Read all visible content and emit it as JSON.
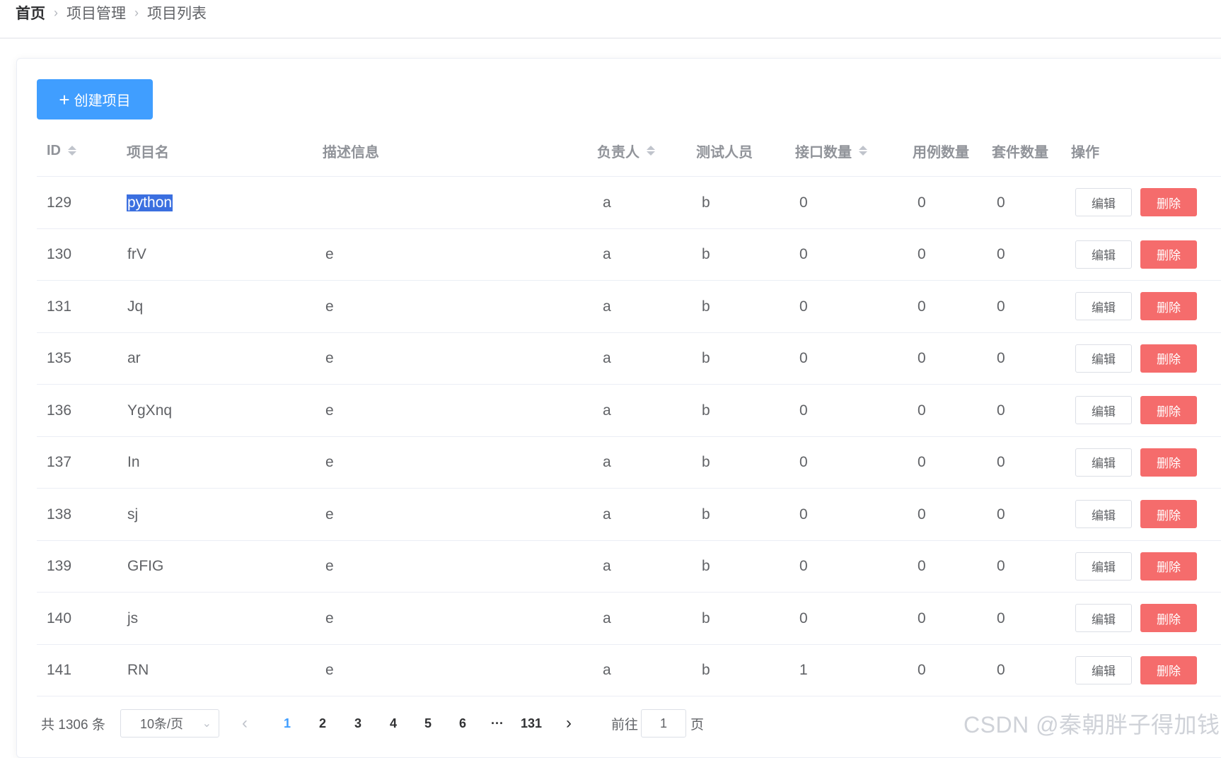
{
  "breadcrumb": [
    "首页",
    "项目管理",
    "项目列表"
  ],
  "toolbar": {
    "create_label": "创建项目"
  },
  "table": {
    "columns": {
      "id": "ID",
      "name": "项目名",
      "desc": "描述信息",
      "leader": "负责人",
      "tester": "测试人员",
      "api_count": "接口数量",
      "case_count": "用例数量",
      "suite_count": "套件数量",
      "actions": "操作"
    },
    "rows": [
      {
        "id": "129",
        "name": "python",
        "desc": "",
        "leader": "a",
        "tester": "b",
        "api": "0",
        "cases": "0",
        "suites": "0"
      },
      {
        "id": "130",
        "name": "frV",
        "desc": "e",
        "leader": "a",
        "tester": "b",
        "api": "0",
        "cases": "0",
        "suites": "0"
      },
      {
        "id": "131",
        "name": "Jq",
        "desc": "e",
        "leader": "a",
        "tester": "b",
        "api": "0",
        "cases": "0",
        "suites": "0"
      },
      {
        "id": "135",
        "name": "ar",
        "desc": "e",
        "leader": "a",
        "tester": "b",
        "api": "0",
        "cases": "0",
        "suites": "0"
      },
      {
        "id": "136",
        "name": "YgXnq",
        "desc": "e",
        "leader": "a",
        "tester": "b",
        "api": "0",
        "cases": "0",
        "suites": "0"
      },
      {
        "id": "137",
        "name": "In",
        "desc": "e",
        "leader": "a",
        "tester": "b",
        "api": "0",
        "cases": "0",
        "suites": "0"
      },
      {
        "id": "138",
        "name": "sj",
        "desc": "e",
        "leader": "a",
        "tester": "b",
        "api": "0",
        "cases": "0",
        "suites": "0"
      },
      {
        "id": "139",
        "name": "GFIG",
        "desc": "e",
        "leader": "a",
        "tester": "b",
        "api": "0",
        "cases": "0",
        "suites": "0"
      },
      {
        "id": "140",
        "name": "js",
        "desc": "e",
        "leader": "a",
        "tester": "b",
        "api": "0",
        "cases": "0",
        "suites": "0"
      },
      {
        "id": "141",
        "name": "RN",
        "desc": "e",
        "leader": "a",
        "tester": "b",
        "api": "1",
        "cases": "0",
        "suites": "0"
      }
    ],
    "edit_label": "编辑",
    "delete_label": "删除"
  },
  "pagination": {
    "total_text": "共 1306 条",
    "page_size": "10条/页",
    "pages": [
      "1",
      "2",
      "3",
      "4",
      "5",
      "6"
    ],
    "ellipsis": "···",
    "last_page": "131",
    "current": "1",
    "goto_prefix": "前往",
    "goto_value": "1",
    "goto_suffix": "页"
  },
  "watermark": "CSDN @秦朝胖子得加钱",
  "colors": {
    "primary": "#409eff",
    "danger": "#f56c6c",
    "border": "#ebeef5"
  }
}
